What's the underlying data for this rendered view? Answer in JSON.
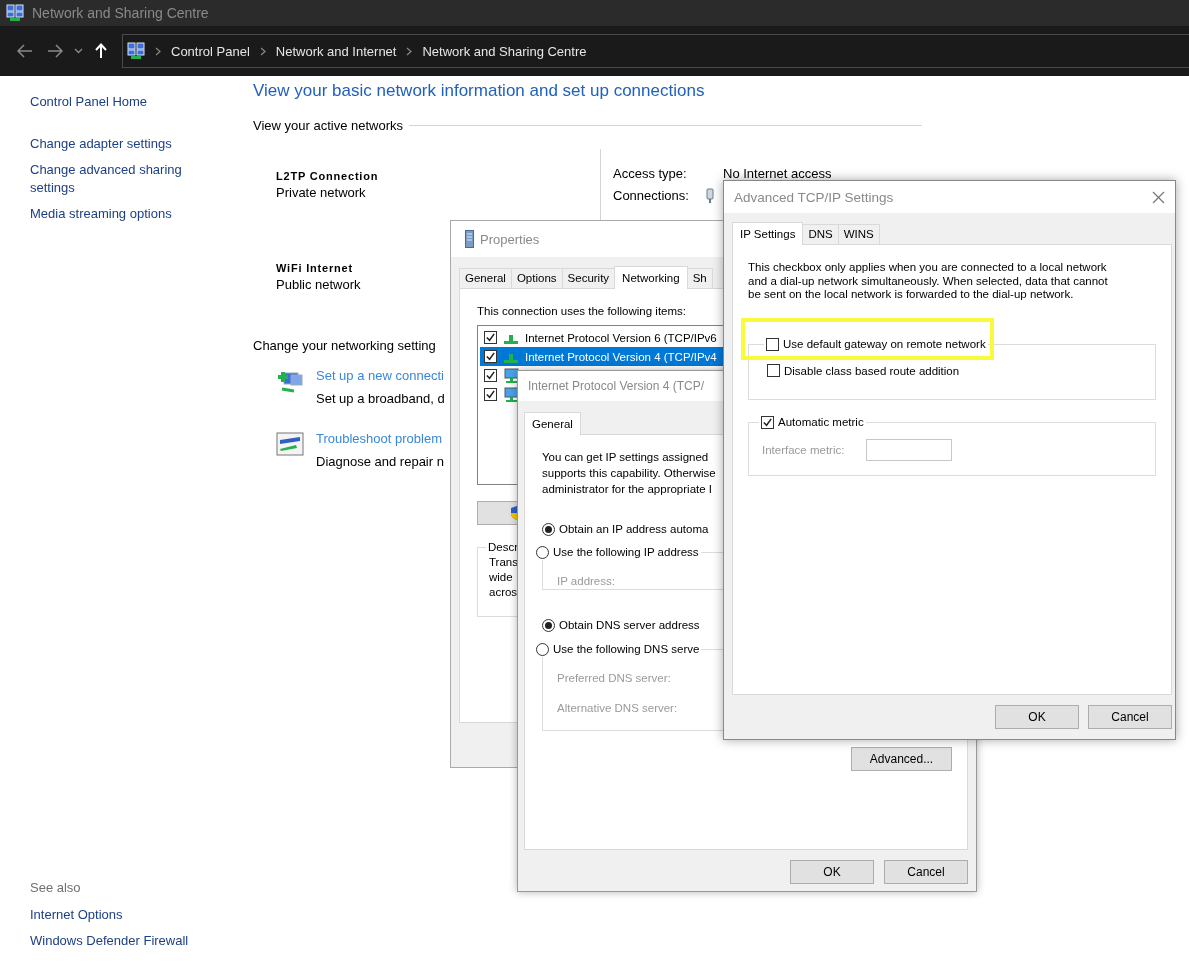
{
  "window": {
    "title": "Network and Sharing Centre"
  },
  "address_bar": {
    "breadcrumbs": [
      "Control Panel",
      "Network and Internet",
      "Network and Sharing Centre"
    ]
  },
  "sidebar": {
    "links": [
      {
        "label": "Control Panel Home",
        "kind": "home"
      },
      {
        "label": "Change adapter settings",
        "kind": "task"
      },
      {
        "label": "Change advanced sharing settings",
        "kind": "task"
      },
      {
        "label": "Media streaming options",
        "kind": "task"
      }
    ],
    "see_also": {
      "heading": "See also",
      "links": [
        "Internet Options",
        "Windows Defender Firewall"
      ]
    }
  },
  "main": {
    "heading": "View your basic network information and set up connections",
    "active_networks_label": "View your active networks",
    "access_label": "Access type:",
    "connections_label": "Connections:",
    "networks": [
      {
        "name": "L2TP Connection",
        "category": "Private network",
        "access_type": "No Internet access"
      },
      {
        "name": "WiFi Internet",
        "category": "Public network"
      }
    ],
    "settings_heading": "Change your networking setting",
    "tasks": [
      {
        "kind": "new-connection",
        "link": "Set up a new connecti",
        "description": "Set up a broadband, d"
      },
      {
        "kind": "troubleshoot",
        "link": "Troubleshoot problem",
        "description": "Diagnose and repair n"
      }
    ]
  },
  "properties_dialog": {
    "title": "Properties",
    "tabs": [
      {
        "label": "General",
        "selected": false
      },
      {
        "label": "Options",
        "selected": false
      },
      {
        "label": "Security",
        "selected": false
      },
      {
        "label": "Networking",
        "selected": true
      },
      {
        "label": "Sh",
        "selected": false
      }
    ],
    "items_label": "This connection uses the following items:",
    "items": [
      {
        "kind": "protocol",
        "label": "Internet Protocol Version 6 (TCP/IPv6",
        "checked": true,
        "selected": false
      },
      {
        "kind": "protocol",
        "label": "Internet Protocol Version 4 (TCP/IPv4",
        "checked": true,
        "selected": true
      },
      {
        "kind": "client",
        "checked": true,
        "selected": false
      },
      {
        "kind": "client",
        "checked": true,
        "selected": false
      }
    ],
    "description_label": "Descr",
    "description_lines": [
      "Trans",
      "wide",
      "acros"
    ]
  },
  "ipv4_dialog": {
    "title": "Internet Protocol Version 4 (TCP/",
    "tabs": [
      {
        "label": "General",
        "selected": true
      }
    ],
    "intro_lines": [
      "You can get IP settings assigned",
      "supports this capability. Otherwise",
      "administrator for the appropriate I"
    ],
    "ip_options": [
      {
        "label": "Obtain an IP address automa",
        "selected": true
      },
      {
        "label": "Use the following IP address",
        "selected": false
      }
    ],
    "ip_fields": [
      {
        "label": "IP address:",
        "disabled": true
      }
    ],
    "dns_options": [
      {
        "label": "Obtain DNS server address",
        "selected": true
      },
      {
        "label": "Use the following DNS serve",
        "selected": false
      }
    ],
    "dns_fields": [
      {
        "label": "Preferred DNS server:",
        "disabled": true
      },
      {
        "label": "Alternative DNS server:",
        "disabled": true
      }
    ],
    "advanced_button": "Advanced...",
    "buttons": [
      "OK",
      "Cancel"
    ]
  },
  "advanced_dialog": {
    "title": "Advanced TCP/IP Settings",
    "tabs": [
      {
        "label": "IP Settings",
        "selected": true
      },
      {
        "label": "DNS",
        "selected": false
      },
      {
        "label": "WINS",
        "selected": false
      }
    ],
    "intro": "This checkbox only applies when you are connected to a local network and a dial-up network simultaneously. When selected, data that cannot be sent on the local network is forwarded to the dial-up network.",
    "gateway": {
      "label": "Use default gateway on remote network",
      "checked": false,
      "highlighted": true
    },
    "class_route": {
      "label": "Disable class based route addition",
      "checked": false
    },
    "automatic_metric": {
      "label": "Automatic metric",
      "checked": true
    },
    "interface_metric": {
      "label": "Interface metric:",
      "disabled": true
    },
    "buttons": [
      "OK",
      "Cancel"
    ]
  }
}
